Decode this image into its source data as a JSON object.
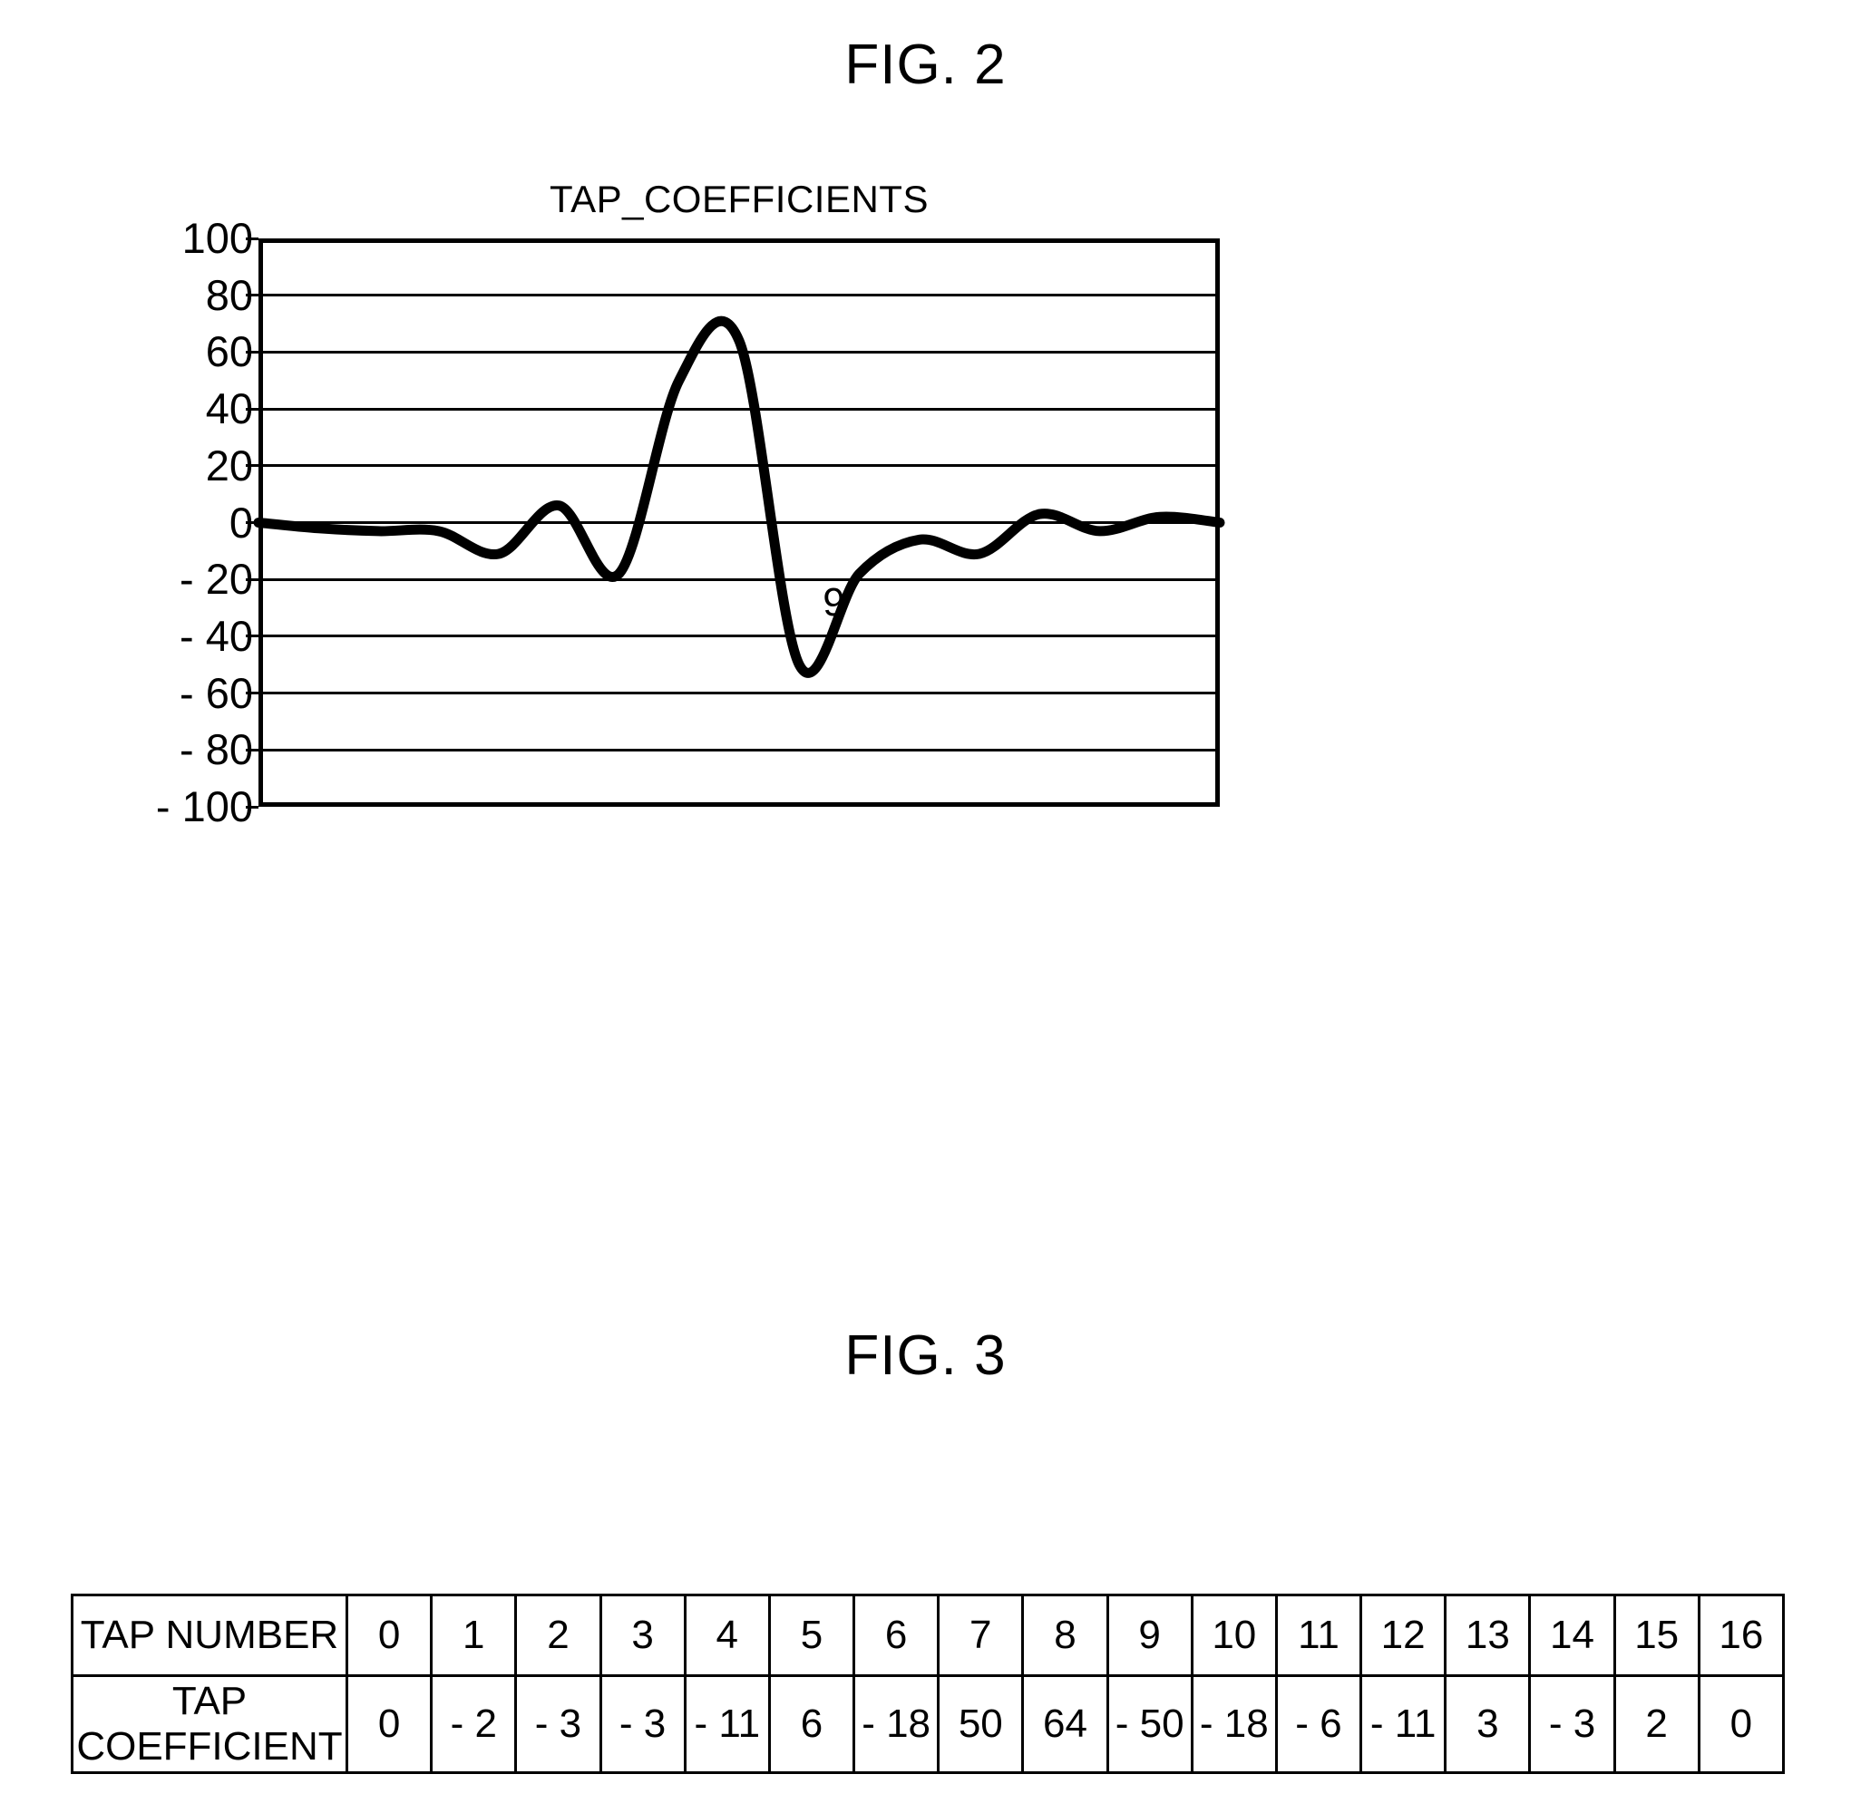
{
  "figures": {
    "fig2_heading": "FIG. 2",
    "fig3_heading": "FIG. 3"
  },
  "chart_data": {
    "type": "line",
    "title": "TAP_COEFFICIENTS",
    "xlabel": "",
    "ylabel": "",
    "ylim": [
      -100,
      100
    ],
    "xlim": [
      0,
      16
    ],
    "grid": true,
    "legend": false,
    "y_ticks": [
      "100",
      "80",
      "60",
      "40",
      "20",
      "0",
      "- 20",
      "- 40",
      "- 60",
      "- 80",
      "- 100"
    ],
    "y_tick_values": [
      100,
      80,
      60,
      40,
      20,
      0,
      -20,
      -40,
      -60,
      -80,
      -100
    ],
    "x": [
      0,
      1,
      2,
      3,
      4,
      5,
      6,
      7,
      8,
      9,
      10,
      11,
      12,
      13,
      14,
      15,
      16
    ],
    "values": [
      0,
      -2,
      -3,
      -3,
      -11,
      6,
      -18,
      50,
      64,
      -50,
      -18,
      -6,
      -11,
      3,
      -3,
      2,
      0
    ],
    "series": [
      {
        "name": "TAP_COEFFICIENTS",
        "values": [
          0,
          -2,
          -3,
          -3,
          -11,
          6,
          -18,
          50,
          64,
          -50,
          -18,
          -6,
          -11,
          3,
          -3,
          2,
          0
        ]
      }
    ],
    "annotations": [
      {
        "text": "9",
        "x": 9,
        "y": -20
      }
    ],
    "line_color": "#000000"
  },
  "table": {
    "row_number_label": "TAP NUMBER",
    "row_coefficient_label_line1": "TAP",
    "row_coefficient_label_line2": "COEFFICIENT",
    "tap_numbers": [
      "0",
      "1",
      "2",
      "3",
      "4",
      "5",
      "6",
      "7",
      "8",
      "9",
      "10",
      "11",
      "12",
      "13",
      "14",
      "15",
      "16"
    ],
    "tap_coefficients": [
      "0",
      "- 2",
      "- 3",
      "- 3",
      "- 11",
      "6",
      "- 18",
      "50",
      "64",
      "- 50",
      "- 18",
      "- 6",
      "- 11",
      "3",
      "- 3",
      "2",
      "0"
    ]
  }
}
